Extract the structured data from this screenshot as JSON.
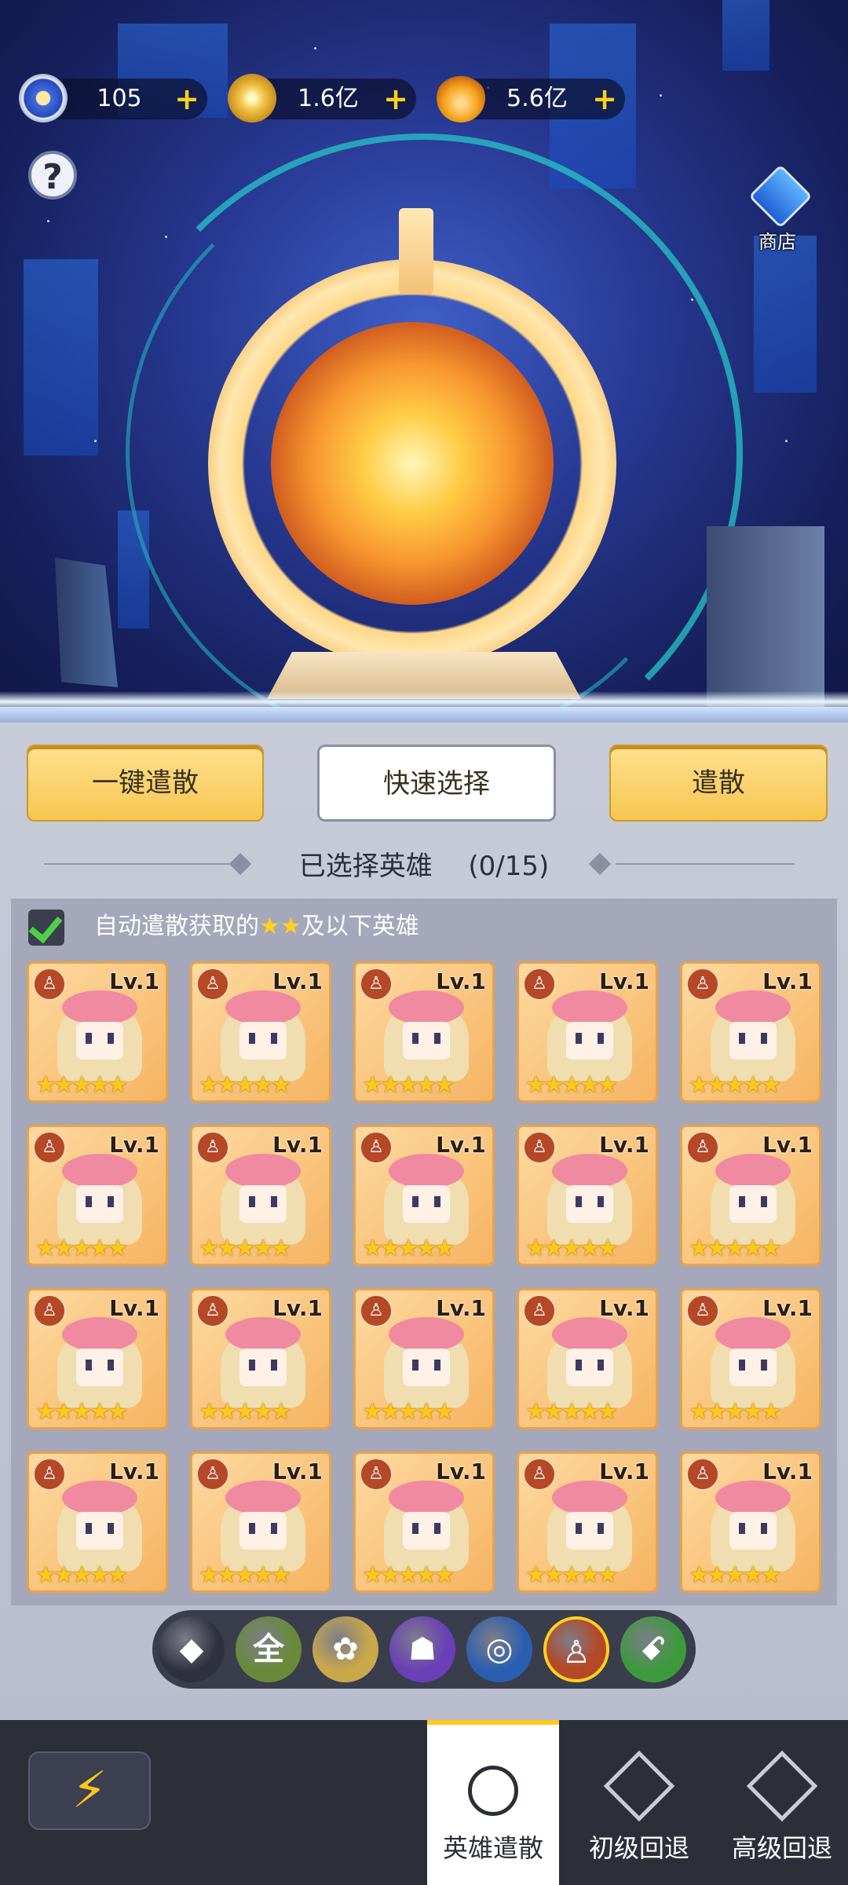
{
  "currencies": [
    {
      "name": "gear-icon",
      "value": "105"
    },
    {
      "name": "coin-icon",
      "value": "1.6亿"
    },
    {
      "name": "lotus-icon",
      "value": "5.6亿"
    }
  ],
  "help_icon": "?",
  "shop_label": "商店",
  "buttons": {
    "one_click": "一键遣散",
    "quick_select": "快速选择",
    "dismiss": "遣散"
  },
  "selected": {
    "label": "已选择英雄",
    "count": "(0/15)"
  },
  "auto_dismiss": {
    "checked": true,
    "prefix": "自动遣散获取的",
    "stars": "★★",
    "suffix": "及以下英雄"
  },
  "heroes": {
    "level_label": "Lv.1",
    "stars": 5,
    "rows": 4,
    "cols": 5
  },
  "filters": [
    {
      "name": "all-diamond-filter",
      "label": "◆",
      "color": "#2f3140"
    },
    {
      "name": "all-element-filter",
      "label": "全",
      "color": "#6a8a3a"
    },
    {
      "name": "light-lotus-filter",
      "label": "✿",
      "color": "#c9a84a"
    },
    {
      "name": "dark-flame-filter",
      "label": "☗",
      "color": "#6a3fb8"
    },
    {
      "name": "water-swirl-filter",
      "label": "◎",
      "color": "#2a5fb0"
    },
    {
      "name": "meditate-filter",
      "label": "♙",
      "color": "#b54826"
    },
    {
      "name": "nature-dna-filter",
      "label": "ꗃ",
      "color": "#3c9a3c"
    }
  ],
  "nav": {
    "back_icon": "⚡",
    "tabs": [
      {
        "label": "英雄遣散",
        "active": true
      },
      {
        "label": "初级回退",
        "active": false
      },
      {
        "label": "高级回退",
        "active": false
      }
    ]
  }
}
